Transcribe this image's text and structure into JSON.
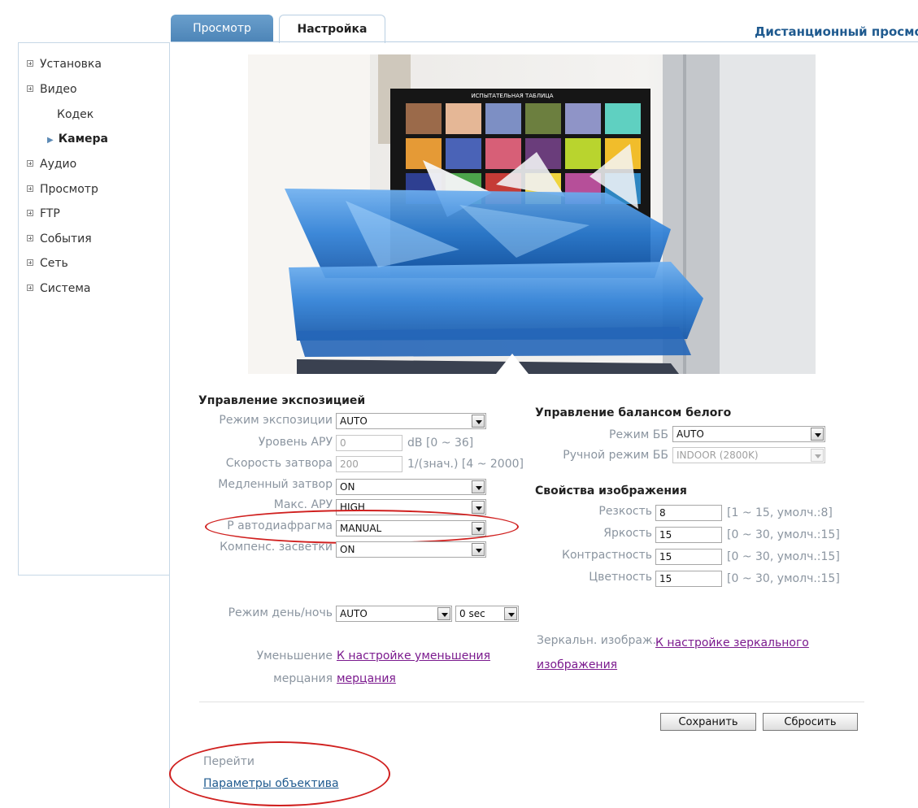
{
  "tabs": [
    {
      "label": "Просмотр"
    },
    {
      "label": "Настройка"
    }
  ],
  "header": {
    "title": "Дистанционный просмотр"
  },
  "sidebar": {
    "items": [
      {
        "label": "Установка"
      },
      {
        "label": "Видео"
      },
      {
        "label": "Аудио"
      },
      {
        "label": "Просмотр"
      },
      {
        "label": "FTP"
      },
      {
        "label": "События"
      },
      {
        "label": "Сеть"
      },
      {
        "label": "Система"
      }
    ],
    "video_subitems": [
      {
        "label": "Кодек"
      },
      {
        "label": "Камера"
      }
    ]
  },
  "preview": {
    "chart_header": "ИСПЫТАТЕЛЬНАЯ ТАБЛИЦА",
    "swatch_colors": [
      "#9b6a4a",
      "#e5b796",
      "#7d8fc4",
      "#6c7f3f",
      "#8f94c7",
      "#5fd0c1",
      "#e59a36",
      "#4a63b7",
      "#d75f77",
      "#6a3d7b",
      "#b9d42e",
      "#f1bd2b",
      "#2e3f91",
      "#4ca44b",
      "#c53b36",
      "#efd43c",
      "#b64f99",
      "#2e86c1"
    ]
  },
  "exposure": {
    "title": "Управление экспозицией",
    "mode_label": "Режим экспозиции",
    "mode_value": "AUTO",
    "agc_label": "Уровень АРУ",
    "agc_value": "0",
    "agc_hint": "dB [0 ~ 36]",
    "shutter_label": "Скорость затвора",
    "shutter_value": "200",
    "shutter_hint": "1/(знач.) [4 ~ 2000]",
    "slow_shutter_label": "Медленный затвор",
    "slow_shutter_value": "ON",
    "max_agc_label": "Макс. АРУ",
    "max_agc_value": "HIGH",
    "iris_label": "Р автодиафрагма",
    "iris_value": "MANUAL",
    "blc_label": "Компенс. засветки",
    "blc_value": "ON",
    "daynight_label": "Режим день/ночь",
    "daynight_value": "AUTO",
    "daynight_delay": "0 sec",
    "flicker_label_1": "Уменьшение",
    "flicker_label_2": "мерцания",
    "flicker_link_1": "К настройке уменьшения",
    "flicker_link_2": "мерцания"
  },
  "white_balance": {
    "title": "Управление балансом белого",
    "mode_label": "Режим ББ",
    "mode_value": "AUTO",
    "manual_label": "Ручной режим ББ",
    "manual_value": "INDOOR (2800K)"
  },
  "image_props": {
    "title": "Свойства изображения",
    "sharpness_label": "Резкость",
    "sharpness_value": "8",
    "sharpness_hint": "[1 ~ 15, умолч.:8]",
    "brightness_label": "Яркость",
    "brightness_value": "15",
    "brightness_hint": "[0 ~ 30, умолч.:15]",
    "contrast_label": "Контрастность",
    "contrast_value": "15",
    "contrast_hint": "[0 ~ 30, умолч.:15]",
    "color_label": "Цветность",
    "color_value": "15",
    "color_hint": "[0 ~ 30, умолч.:15]"
  },
  "mirror": {
    "label": "Зеркальн. изображ.",
    "link_1": "К настройке зеркального",
    "link_2": "изображения"
  },
  "actions": {
    "save": "Сохранить",
    "reset": "Сбросить"
  },
  "goto": {
    "label": "Перейти",
    "lens_link": "Параметры объектива"
  }
}
